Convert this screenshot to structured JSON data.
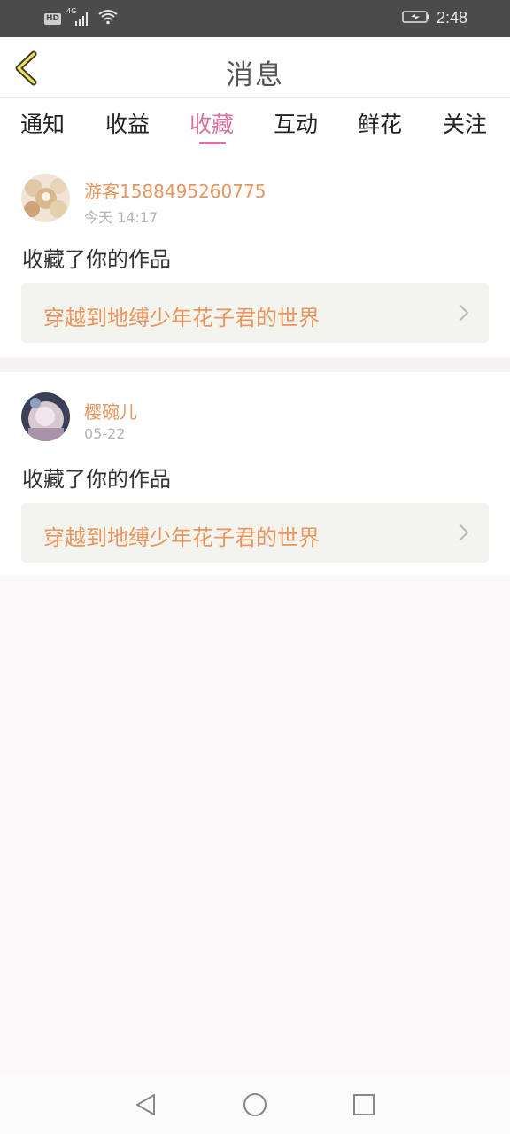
{
  "status_bar": {
    "hd": "HD",
    "network": "4G",
    "time": "2:48"
  },
  "header": {
    "title": "消息"
  },
  "tabs": [
    {
      "label": "通知",
      "active": false
    },
    {
      "label": "收益",
      "active": false
    },
    {
      "label": "收藏",
      "active": true
    },
    {
      "label": "互动",
      "active": false
    },
    {
      "label": "鲜花",
      "active": false
    },
    {
      "label": "关注",
      "active": false
    }
  ],
  "messages": [
    {
      "username": "游客1588495260775",
      "time": "今天 14:17",
      "action": "收藏了你的作品",
      "work_title": "穿越到地缚少年花子君的世界"
    },
    {
      "username": "樱碗儿",
      "time": "05-22",
      "action": "收藏了你的作品",
      "work_title": "穿越到地缚少年花子君的世界"
    }
  ],
  "colors": {
    "accent": "#d9709d",
    "username": "#e8955e",
    "link_bg": "#f4f4ee"
  },
  "icons": {
    "back": "chevron-left-icon",
    "link": "chevron-right-icon",
    "nav": [
      "back-triangle-icon",
      "home-circle-icon",
      "recents-square-icon"
    ]
  }
}
